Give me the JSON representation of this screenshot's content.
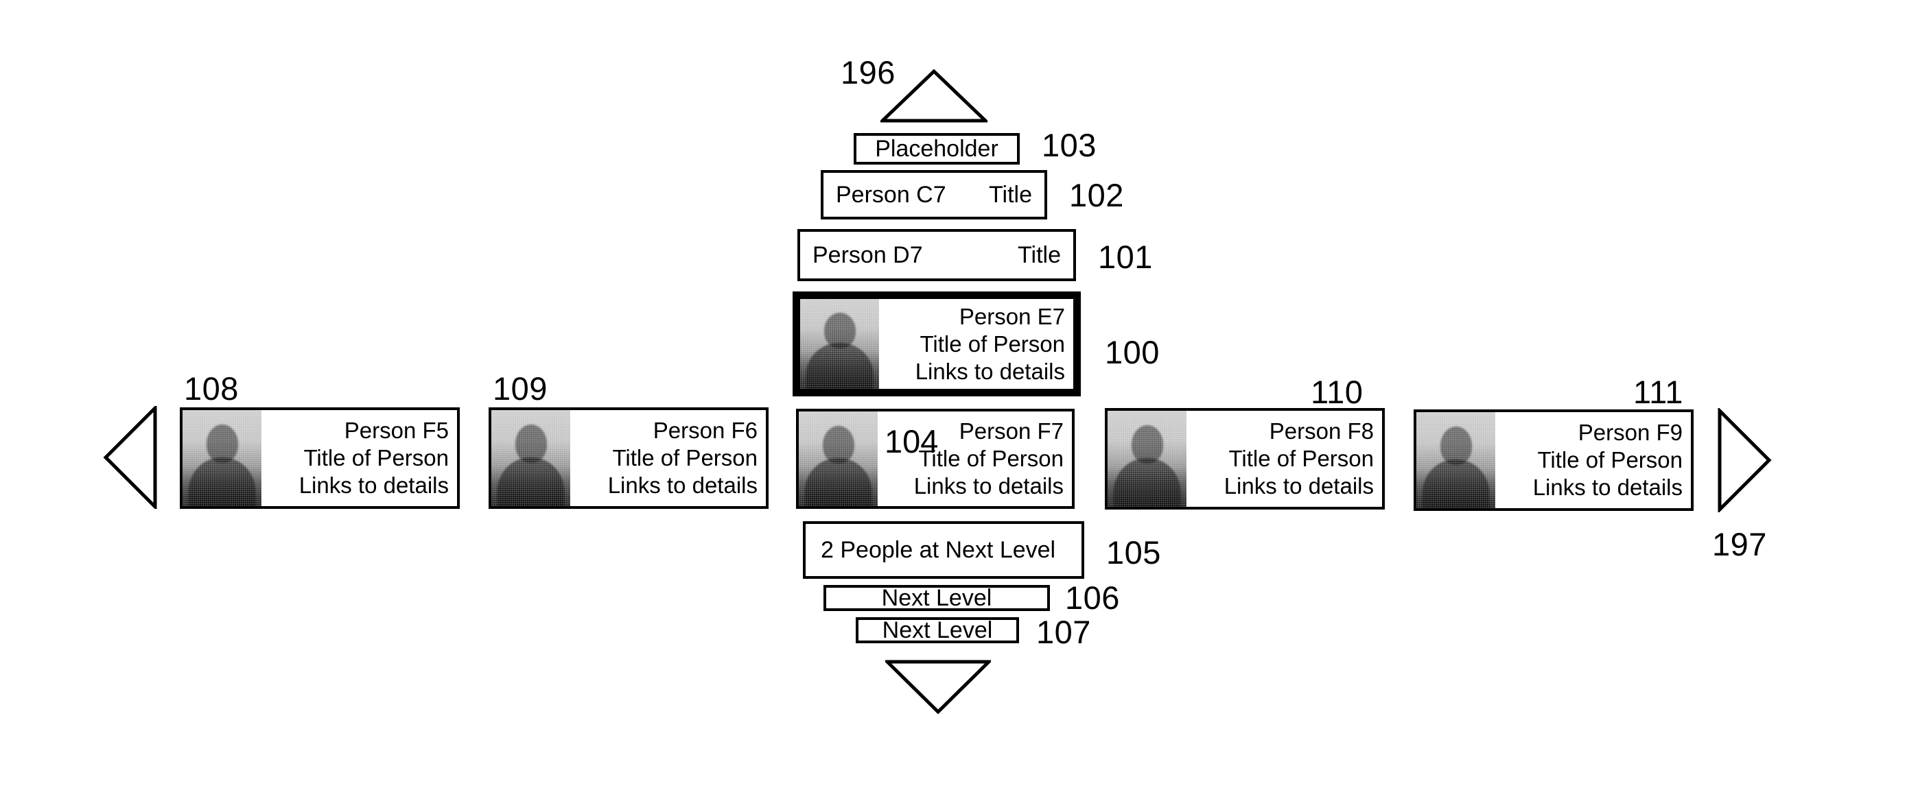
{
  "figure": {
    "type": "org-hierarchy-browser",
    "background_color": "#ffffff",
    "line_color": "#000000",
    "highlight_border_color": "#000000"
  },
  "scroll_up": {
    "ref": "196",
    "icon": "triangle-up-icon",
    "role": "scroll-up-affordance"
  },
  "scroll_down": {
    "ref": "107b",
    "icon": "triangle-down-icon",
    "role": "scroll-down-affordance"
  },
  "page_left": {
    "ref": "108a",
    "icon": "triangle-left-icon",
    "role": "page-left-affordance"
  },
  "page_right": {
    "ref": "197",
    "icon": "triangle-right-icon",
    "role": "page-right-affordance"
  },
  "ancestors": [
    {
      "ref": "103",
      "name": "placeholder-row",
      "label": "Placeholder",
      "align": "center"
    },
    {
      "ref": "102",
      "name": "ancestor-row-c7",
      "left_label": "Person C7",
      "right_label": "Title",
      "align": "spread"
    },
    {
      "ref": "101",
      "name": "ancestor-row-d7",
      "left_label": "Person D7",
      "right_label": "Title",
      "align": "spread"
    }
  ],
  "selected_card": {
    "ref": "100",
    "name": "Person E7",
    "title": "Title of Person",
    "links": "Links to details",
    "selected": true
  },
  "peer_cards": [
    {
      "ref": "108",
      "name": "Person F5",
      "title": "Title of Person",
      "links": "Links to details",
      "ref_position": "above-left"
    },
    {
      "ref": "109",
      "name": "Person F6",
      "title": "Title of Person",
      "links": "Links to details",
      "ref_position": "above-left"
    },
    {
      "ref": "104",
      "name": "Person F7",
      "title": "Title of Person",
      "links": "Links to details",
      "ref_position": "inside"
    },
    {
      "ref": "110",
      "name": "Person F8",
      "title": "Title of Person",
      "links": "Links to details",
      "ref_position": "above-right"
    },
    {
      "ref": "111",
      "name": "Person F9",
      "title": "Title of Person",
      "links": "Links to details",
      "ref_position": "above-right"
    }
  ],
  "descendants": [
    {
      "ref": "105",
      "name": "people-count-row",
      "label": "2 People at Next Level",
      "align": "left",
      "count": 2
    },
    {
      "ref": "106",
      "name": "next-level-row-1",
      "label": "Next Level",
      "align": "center"
    },
    {
      "ref": "107",
      "name": "next-level-row-2",
      "label": "Next Level",
      "align": "center"
    }
  ]
}
